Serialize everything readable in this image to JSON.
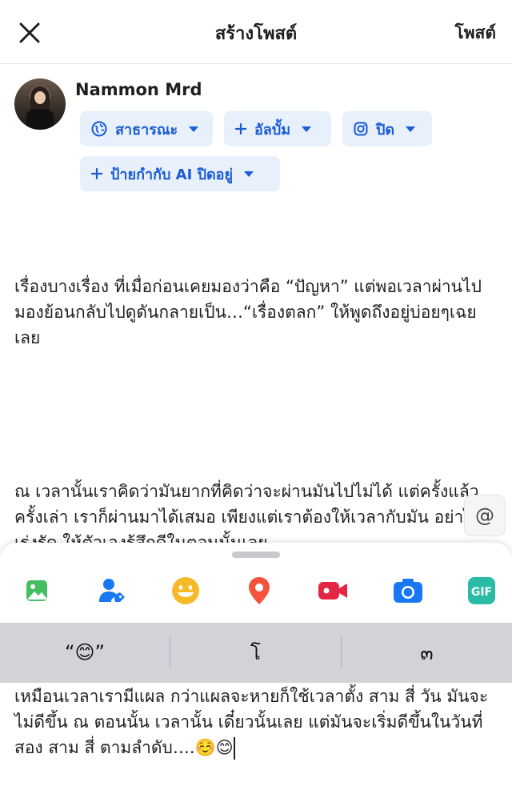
{
  "header": {
    "title": "สร้างโพสต์",
    "post_label": "โพสต์"
  },
  "user": {
    "name": "Nammon Mrd"
  },
  "chips": {
    "audience": "สาธารณะ",
    "album": "อัลบั้ม",
    "instagram": "ปิด",
    "ai_label": "ป้ายกำกับ AI ปิดอยู่"
  },
  "post": {
    "paragraph1": "เรื่องบางเรื่อง ที่เมื่อก่อนเคยมองว่าคือ “ปัญหา” แต่พอเวลาผ่านไป มองย้อนกลับไปดูดันกลายเป็น…“เรื่องตลก” ให้พูดถึงอยู่บ่อยๆเฉยเลย",
    "paragraph2": "ณ เวลานั้นเราคิดว่ามันยากที่คิดว่าจะผ่านมันไปไม่ได้ แต่ครั้งแล้วครั้งเล่า เราก็ผ่านมาได้เสมอ เพียงแต่เราต้องให้เวลากับมัน อย่าไปเร่งรัด ให้ตัวเองรู้สึกดีในตอนนั้นเลย",
    "paragraph3": "เหมือนเวลาเรามีแผล กว่าแผลจะหายก็ใช้เวลาตั้ง สาม สี่ วัน มันจะไม่ดีขึ้น ณ ตอนนั้น เวลานั้น เดี๋ยวนั้นเลย แต่มันจะเริ่มดีขึ้นในวันที่ สอง สาม สี่ ตามลำดับ….☺️😊"
  },
  "mention_button": "@",
  "keyboard": {
    "suggestion1": "“😊”",
    "suggestion2": "โ",
    "suggestion3": "๓"
  },
  "colors": {
    "accent": "#1a5bd6",
    "chip_bg": "#e7f0fb",
    "photo_icon": "#45bd62",
    "tag_icon": "#1877f2",
    "emoji_icon": "#f7b928",
    "location_icon": "#f5533d",
    "video_icon": "#e42645",
    "camera_icon": "#1877f2",
    "gif_icon": "#2abba7"
  },
  "icons": [
    "close-icon",
    "globe-icon",
    "plus-icon",
    "instagram-icon",
    "photo-icon",
    "tag-person-icon",
    "emoji-icon",
    "location-icon",
    "live-video-icon",
    "camera-icon",
    "gif-icon"
  ]
}
